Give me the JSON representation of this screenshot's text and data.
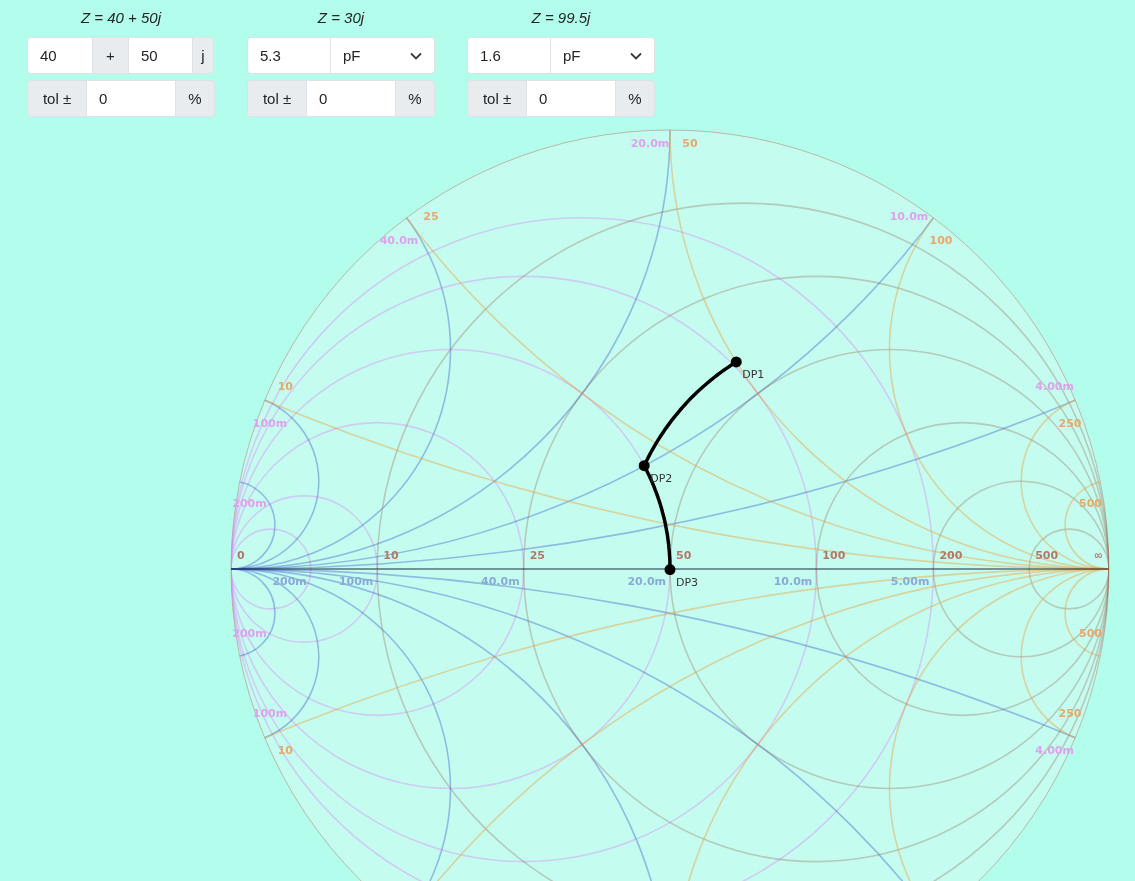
{
  "components": [
    {
      "kind": "impedance",
      "title": "Z = 40 + 50j",
      "real": "40",
      "sign": "+",
      "imag": "50",
      "unit": "j",
      "tolerance_label": "tol ±",
      "tolerance": "0",
      "percent": "%"
    },
    {
      "kind": "series_capacitor",
      "title": "Z = 30j",
      "value": "5.3",
      "unit": "pF",
      "tolerance_label": "tol ±",
      "tolerance": "0",
      "percent": "%"
    },
    {
      "kind": "shunt_capacitor",
      "title": "Z = 99.5j",
      "value": "1.6",
      "unit": "pF",
      "tolerance_label": "tol ±",
      "tolerance": "0",
      "percent": "%"
    }
  ],
  "chart": {
    "resistance_labels": [
      "0",
      "10",
      "25",
      "50",
      "100",
      "200",
      "500",
      "∞"
    ],
    "conductance_labels": [
      "200m",
      "100m",
      "40.0m",
      "20.0m",
      "10.0m",
      "5.00m"
    ],
    "reactance_labels_upper": [
      "10",
      "25",
      "50",
      "100",
      "250",
      "500"
    ],
    "reactance_labels_lower": [
      "10",
      "250",
      "500"
    ],
    "susceptance_labels_upper": [
      "200m",
      "100m",
      "40.0m",
      "20.0m",
      "10.0m",
      "4.00m"
    ],
    "susceptance_labels_lower": [
      "200m",
      "100m",
      "4.00m"
    ],
    "points": [
      "DP1",
      "DP2",
      "DP3"
    ]
  }
}
